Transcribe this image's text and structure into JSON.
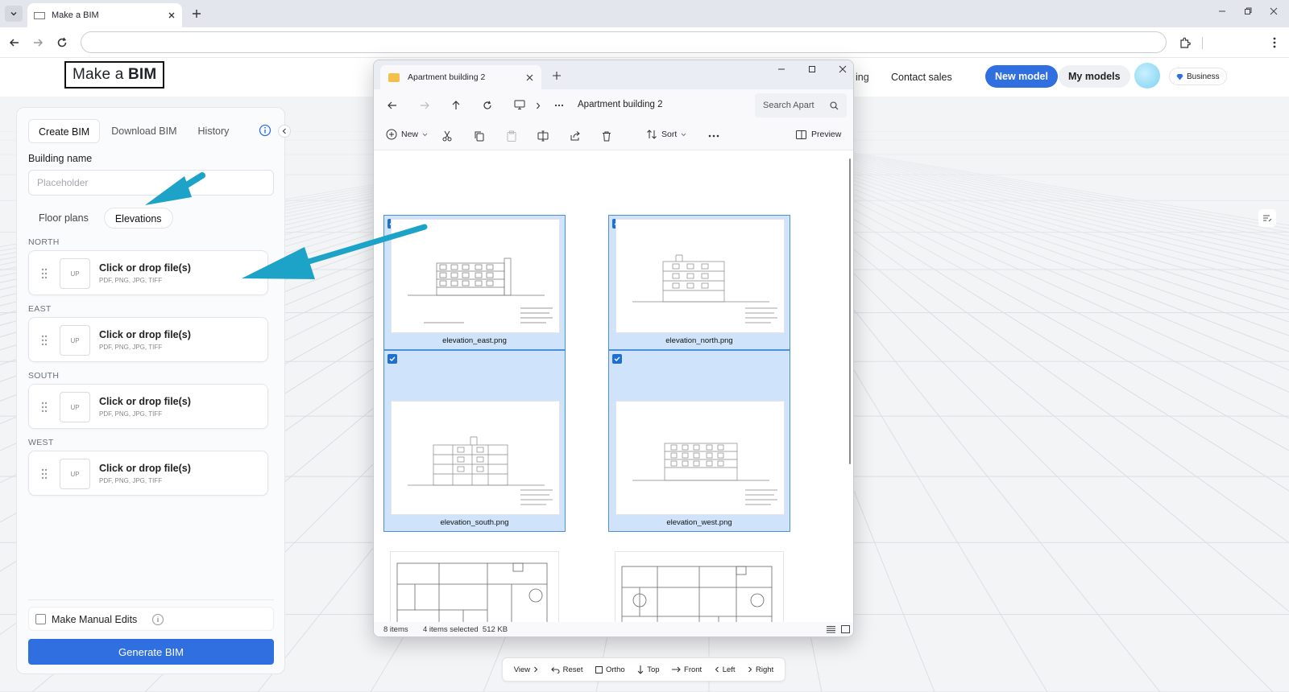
{
  "browser": {
    "tab_title": "Make a BIM",
    "address": ""
  },
  "header": {
    "logo_prefix": "Make a ",
    "logo_bold": "BIM",
    "nav_partial": "ing",
    "contact_sales": "Contact sales",
    "new_model": "New model",
    "my_models": "My models",
    "plan_badge": "Business"
  },
  "panel": {
    "tabs": [
      "Create BIM",
      "Download BIM",
      "History"
    ],
    "building_name_label": "Building name",
    "building_name_placeholder": "Placeholder",
    "segments": [
      "Floor plans",
      "Elevations"
    ],
    "active_segment": "Elevations",
    "upload_sections": [
      {
        "direction": "NORTH",
        "title": "Click or drop file(s)",
        "formats": "PDF, PNG, JPG, TIFF",
        "icon_text": "UP"
      },
      {
        "direction": "EAST",
        "title": "Click or drop file(s)",
        "formats": "PDF, PNG, JPG, TIFF",
        "icon_text": "UP"
      },
      {
        "direction": "SOUTH",
        "title": "Click or drop file(s)",
        "formats": "PDF, PNG, JPG, TIFF",
        "icon_text": "UP"
      },
      {
        "direction": "WEST",
        "title": "Click or drop file(s)",
        "formats": "PDF, PNG, JPG, TIFF",
        "icon_text": "UP"
      }
    ],
    "manual_edits_label": "Make Manual Edits",
    "manual_edits_tip": "i",
    "manual_edits_checked": false,
    "generate_label": "Generate BIM"
  },
  "view_toolbar": {
    "items": [
      "View",
      "Reset",
      "Ortho",
      "Top",
      "Front",
      "Left",
      "Right"
    ]
  },
  "explorer": {
    "tab_title": "Apartment building 2",
    "breadcrumb": "Apartment building 2",
    "search_placeholder": "Search Apart",
    "commands": {
      "new": "New",
      "sort": "Sort",
      "preview": "Preview"
    },
    "files": [
      {
        "name": "elevation_east.png",
        "selected": true
      },
      {
        "name": "elevation_north.png",
        "selected": true
      },
      {
        "name": "elevation_south.png",
        "selected": true
      },
      {
        "name": "elevation_west.png",
        "selected": true
      },
      {
        "name": "",
        "selected": false
      },
      {
        "name": "",
        "selected": false
      }
    ],
    "status_count": "8 items",
    "status_selection": "4 items selected  512 KB"
  },
  "colors": {
    "accent": "#2f6fe0",
    "annotation_arrow": "#1ea3c8",
    "selection_fill": "#cfe4fb",
    "selection_border": "#4d8fd9"
  },
  "icons": [
    "tab-search-icon",
    "back-arrow-icon",
    "forward-arrow-icon",
    "reload-icon",
    "extensions-icon",
    "kebab-menu-icon",
    "info-icon",
    "chevron-left-icon",
    "drag-handle-icon",
    "folder-icon",
    "up-arrow-icon",
    "monitor-icon",
    "search-icon",
    "plus-circle-icon",
    "cut-icon",
    "copy-icon",
    "paste-icon",
    "rename-icon",
    "share-icon",
    "trash-icon",
    "sort-icon",
    "preview-pane-icon",
    "checkbox-checked-icon"
  ]
}
